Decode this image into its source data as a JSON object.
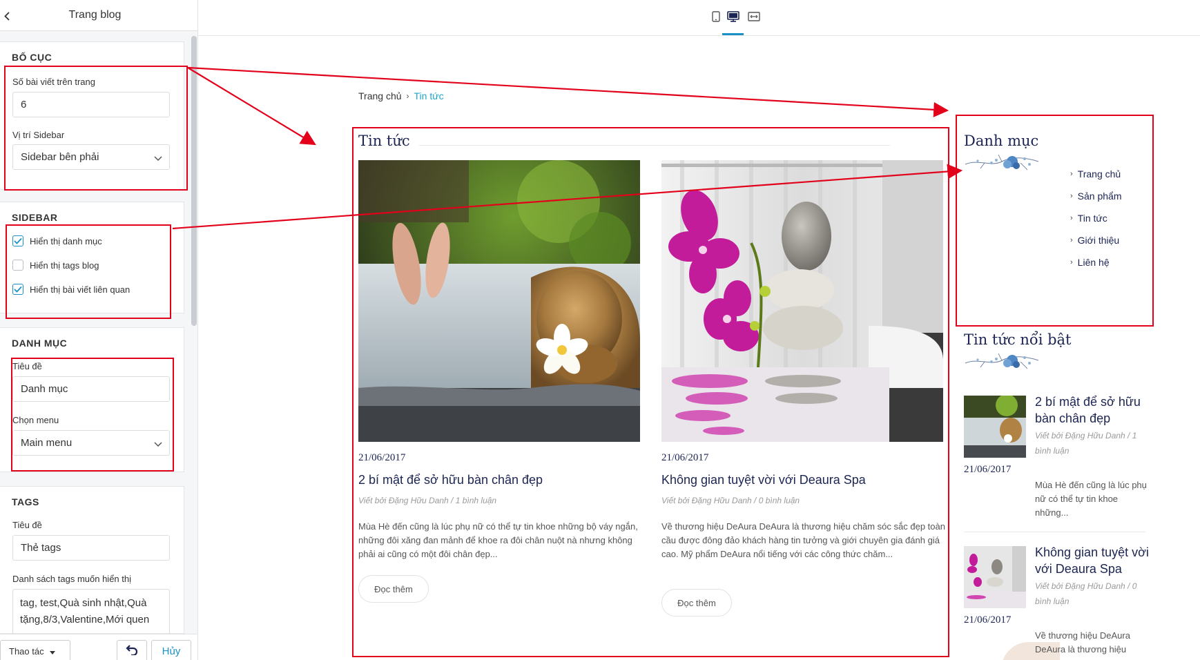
{
  "panel": {
    "title": "Trang blog",
    "layout": {
      "title": "BỐ CỤC",
      "posts_label": "Số bài viết trên trang",
      "posts_value": "6",
      "sidebar_label": "Vị trí Sidebar",
      "sidebar_value": "Sidebar bên phải"
    },
    "sidebar": {
      "title": "SIDEBAR",
      "options": [
        {
          "label": "Hiển thị danh mục",
          "checked": true
        },
        {
          "label": "Hiển thị tags blog",
          "checked": false
        },
        {
          "label": "Hiển thị bài viết liên quan",
          "checked": true
        }
      ]
    },
    "category": {
      "title": "DANH MỤC",
      "title_label": "Tiêu đề",
      "title_value": "Danh mục",
      "menu_label": "Chọn menu",
      "menu_value": "Main menu"
    },
    "tags": {
      "title": "TAGS",
      "title_label": "Tiêu đề",
      "title_value": "Thẻ tags",
      "list_label": "Danh sách tags muốn hiển thị",
      "list_value": "tag, test,Quà sinh nhật,Quà tặng,8/3,Valentine,Mới quen"
    },
    "footer": {
      "action_label": "Thao tác",
      "cancel_label": "Hủy"
    }
  },
  "preview": {
    "breadcrumb": {
      "home": "Trang chủ",
      "current": "Tin tức"
    },
    "main_title": "Tin tức",
    "posts": [
      {
        "date": "21/06/2017",
        "title": "2 bí mật để sở hữu bàn chân đẹp",
        "meta": "Viết bởi Đặng Hữu Danh / 1 bình luận",
        "excerpt": "Mùa Hè đến cũng là lúc phụ nữ có thể tự tin khoe những bộ váy ngắn, những đôi xăng đan mảnh để khoe ra đôi chân nuột nà nhưng không phải ai cũng có một đôi chân đẹp...",
        "read_more": "Đọc thêm"
      },
      {
        "date": "21/06/2017",
        "title": "Không gian tuyệt vời với Deaura Spa",
        "meta": "Viết bởi Đặng Hữu Danh / 0 bình luận",
        "excerpt": "Về thương hiệu DeAura DeAura là thương hiệu chăm sóc sắc đẹp toàn cầu được đông đảo khách hàng tin tưởng và giới chuyên gia đánh giá cao. Mỹ phẩm DeAura nổi tiếng với các công thức chăm...",
        "read_more": "Đọc thêm"
      }
    ],
    "sidebar": {
      "category_title": "Danh mục",
      "menu": [
        "Trang chủ",
        "Sản phẩm",
        "Tin tức",
        "Giới thiệu",
        "Liên hệ"
      ],
      "featured_title": "Tin tức nổi bật",
      "featured": [
        {
          "title": "2 bí mật để sở hữu bàn chân đẹp",
          "meta": "Viết bởi Đặng Hữu Danh / 1 bình luận",
          "date": "21/06/2017",
          "excerpt": "Mùa Hè đến cũng là lúc phụ nữ có thể tự tin khoe những..."
        },
        {
          "title": "Không gian tuyệt vời với Deaura Spa",
          "meta": "Viết bởi Đặng Hữu Danh / 0 bình luận",
          "date": "21/06/2017",
          "excerpt": "Về thương hiệu DeAura DeAura là thương hiệu"
        }
      ]
    }
  },
  "colors": {
    "accent": "#1990c6",
    "heading": "#1b2452",
    "annotation": "#e3001b"
  }
}
